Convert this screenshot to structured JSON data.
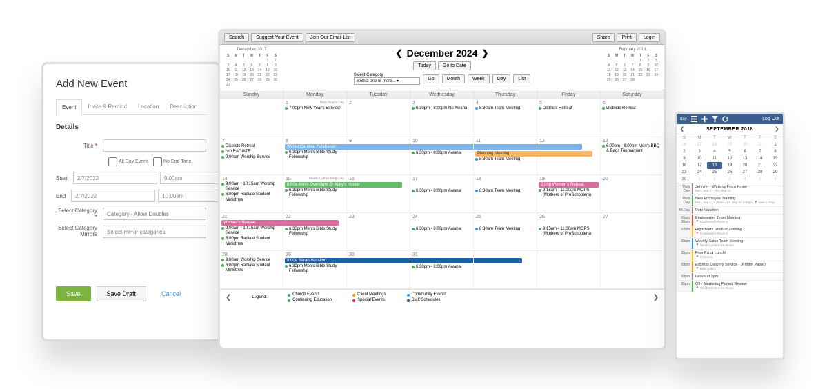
{
  "addEvent": {
    "heading": "Add New Event",
    "tabs": [
      "Event",
      "Invite & Remind",
      "Location",
      "Description"
    ],
    "details_label": "Details",
    "title_label": "Title",
    "allday_label": "All Day Event",
    "noend_label": "No End Time",
    "start_label": "Start",
    "start_date": "2/7/2022",
    "start_time": "9:00am",
    "end_label": "End",
    "end_date": "2/7/2022",
    "end_time": "10:00am",
    "category_label": "Select Category",
    "category_ph": "Category - Allow Doubles",
    "mirrors_label": "Select Category Mirrors",
    "mirrors_ph": "Select mirror categories",
    "save": "Save",
    "save_draft": "Save Draft",
    "cancel": "Cancel"
  },
  "calendar": {
    "toolbar_left": [
      "Search",
      "Suggest Your Event",
      "Join Our Email List"
    ],
    "toolbar_right": [
      "Share",
      "Print",
      "Login"
    ],
    "title": "December 2024",
    "nav_prev": "❮",
    "nav_next": "❯",
    "today": "Today",
    "goto": "Go to Date",
    "select_cat_label": "Select Category",
    "select_cat_ph": "Select one or more...",
    "go": "Go",
    "views": [
      "Month",
      "Week",
      "Day",
      "List"
    ],
    "mini_left_title": "December 2017",
    "mini_right_title": "February 2018",
    "weekdays": [
      "Sunday",
      "Monday",
      "Tuesday",
      "Wednesday",
      "Thursday",
      "Friday",
      "Saturday"
    ],
    "legend_label": "Legend:",
    "legend": {
      "col1": [
        "Church Events",
        "Continuing Education"
      ],
      "col2": [
        "Client Meetings",
        "Special Events"
      ],
      "col3": [
        "Community Events",
        "Staff Schedules"
      ]
    },
    "events": {
      "d1_name": "New Year's Day",
      "d1_ev1": "7:00pm New Year's Service!",
      "d3_ev1": "6:30pm - 8:00pm No Awana",
      "d4_ev1": "8:30am Team Meeting",
      "d5_ev1": "Districts Retreat",
      "d6_ev1": "Districts Retreat",
      "d7_ev1": "Districts Retreat",
      "d7_ev2": "NO RADIATE",
      "d7_ev3": "9:00am Worship Service",
      "d8_bar": "Winter Carnival Fundraiser",
      "d8_ev1": "6:30pm Men's Bible Study Fellowship",
      "d10_ev1": "6:30pm - 8:00pm Awana",
      "d11_bar": "Planning Meeting",
      "d11_ev1": "8:30am Team Meeting",
      "d13_ev1": "6:00pm - 8:00pm Men's BBQ & Bags Tournament",
      "d14_ev1": "9:00am - 10:15am Worship Service",
      "d14_ev2": "6:00pm Radiate Student Ministries",
      "d15_name": "Martin Luther King Day",
      "d15_bar": "8:00a Annie Overnight @ Abby's House",
      "d15_ev1": "6:30pm Men's Bible Study Fellowship",
      "d17_ev1": "6:30pm - 8:00pm Awana",
      "d18_ev1": "8:30am Team Meeting",
      "d19_bar": "2:00p Women's Retreat",
      "d19_ev1": "9:15am - 11:00am MOPS (Mothers of PreSchoolers)",
      "d21_bar": "Women's Retreat",
      "d21_ev1": "9:00am - 10:15am Worship Service",
      "d21_ev2": "6:00pm Radiate Student Ministries",
      "d22_ev1": "6:30pm Men's Bible Study Fellowship",
      "d24_ev1": "6:30pm - 8:00pm Awana",
      "d25_ev1": "8:30am Team Meeting",
      "d26_ev1": "9:15am - 11:00am MOPS (Mothers of PreSchoolers)",
      "d28_ev1": "9:00am Worship Service",
      "d28_ev2": "6:00pm Radiate Student Ministries",
      "d29_bar": "8:00a Sarah Vacation",
      "d29_ev1": "6:30pm Men's Bible Study Fellowship",
      "d31_ev1": "6:30pm - 8:00pm Awana"
    }
  },
  "mobile": {
    "logout": "Log Out",
    "month": "SEPTEMBER 2018",
    "dh": [
      "S",
      "M",
      "T",
      "W",
      "T",
      "F",
      "S"
    ],
    "items": [
      {
        "time": "Multi\nDay",
        "stripe": "#888",
        "title": "Jennifer - Working From Home",
        "sub": "Mon, Sep 17 - Fri, Sep 21"
      },
      {
        "time": "Multi\nDay",
        "stripe": "#4caf50",
        "title": "New Employee Training",
        "sub": "Mon, Sep 17 9:00am - Fri, Sep 21 5:00pm\n📍 Main Lobby"
      },
      {
        "time": "All\nDay",
        "stripe": "#888",
        "title": "Pete Vacation",
        "sub": ""
      },
      {
        "time": "00am\n30am",
        "stripe": "#f44336",
        "title": "Engineering Team Meeting",
        "sub": "📍 Conference Room 1"
      },
      {
        "time": "00am",
        "stripe": "#ffc107",
        "title": "Highcharts Product Training",
        "sub": "📍 Conference Room 1"
      },
      {
        "time": "00am",
        "stripe": "#2196f3",
        "title": "Weekly Sales Team Meeting",
        "sub": "📍 Small Conference Room"
      },
      {
        "time": "30pm",
        "stripe": "#ffc107",
        "title": "Free Pizza Lunch!",
        "sub": "📍 Cafeteria"
      },
      {
        "time": "00pm",
        "stripe": "#ff9800",
        "title": "Express Delivery Service - (Printer Paper)",
        "sub": "📍 Main Lobby"
      },
      {
        "time": "00pm",
        "stripe": "#888",
        "title": "Leave at 3pm",
        "sub": ""
      },
      {
        "time": "30pm",
        "stripe": "#4caf50",
        "title": "Q3 - Marketing Project Review",
        "sub": "📍 Small Conference Room"
      }
    ]
  }
}
